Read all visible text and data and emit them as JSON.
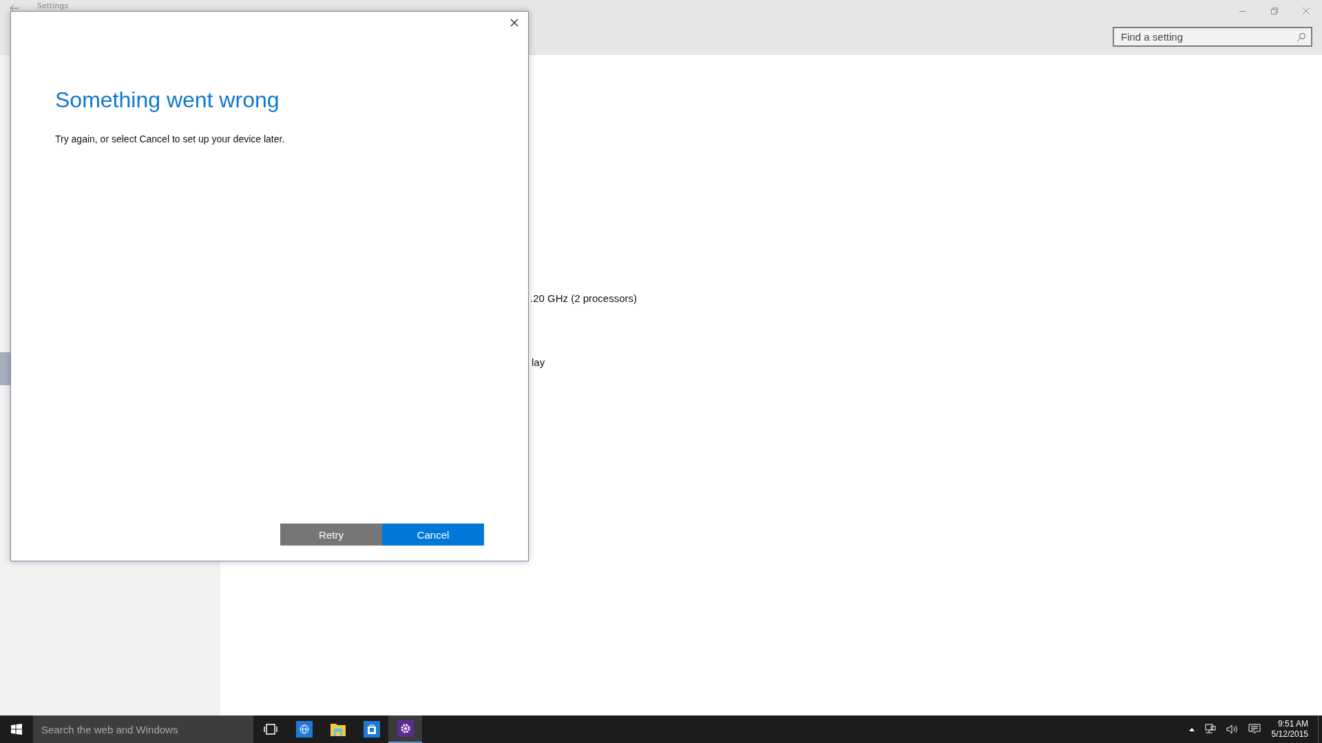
{
  "window": {
    "title": "Settings",
    "search": {
      "placeholder": "Find a setting"
    }
  },
  "sidebar": {
    "items": [
      {
        "selected": false
      },
      {
        "selected": false
      },
      {
        "selected": false
      },
      {
        "selected": false
      },
      {
        "selected": false
      },
      {
        "selected": false
      },
      {
        "selected": false
      },
      {
        "selected": false
      },
      {
        "selected": false
      },
      {
        "selected": true
      }
    ]
  },
  "content": {
    "lines": [
      ".20 GHz  (2 processors)",
      "lay"
    ]
  },
  "dialog": {
    "title": "Something went wrong",
    "message": "Try again, or select Cancel to set up your device later.",
    "buttons": [
      {
        "label": "Retry",
        "kind": "secondary"
      },
      {
        "label": "Cancel",
        "kind": "primary"
      }
    ]
  },
  "taskbar": {
    "search_placeholder": "Search the web and Windows",
    "apps": [
      {
        "kind": "taskview",
        "selected": false
      },
      {
        "kind": "browser",
        "selected": false
      },
      {
        "kind": "explorer",
        "selected": false
      },
      {
        "kind": "store",
        "selected": false
      },
      {
        "kind": "settings",
        "selected": true
      }
    ],
    "time": "9:51 AM",
    "date": "5/12/2015"
  }
}
